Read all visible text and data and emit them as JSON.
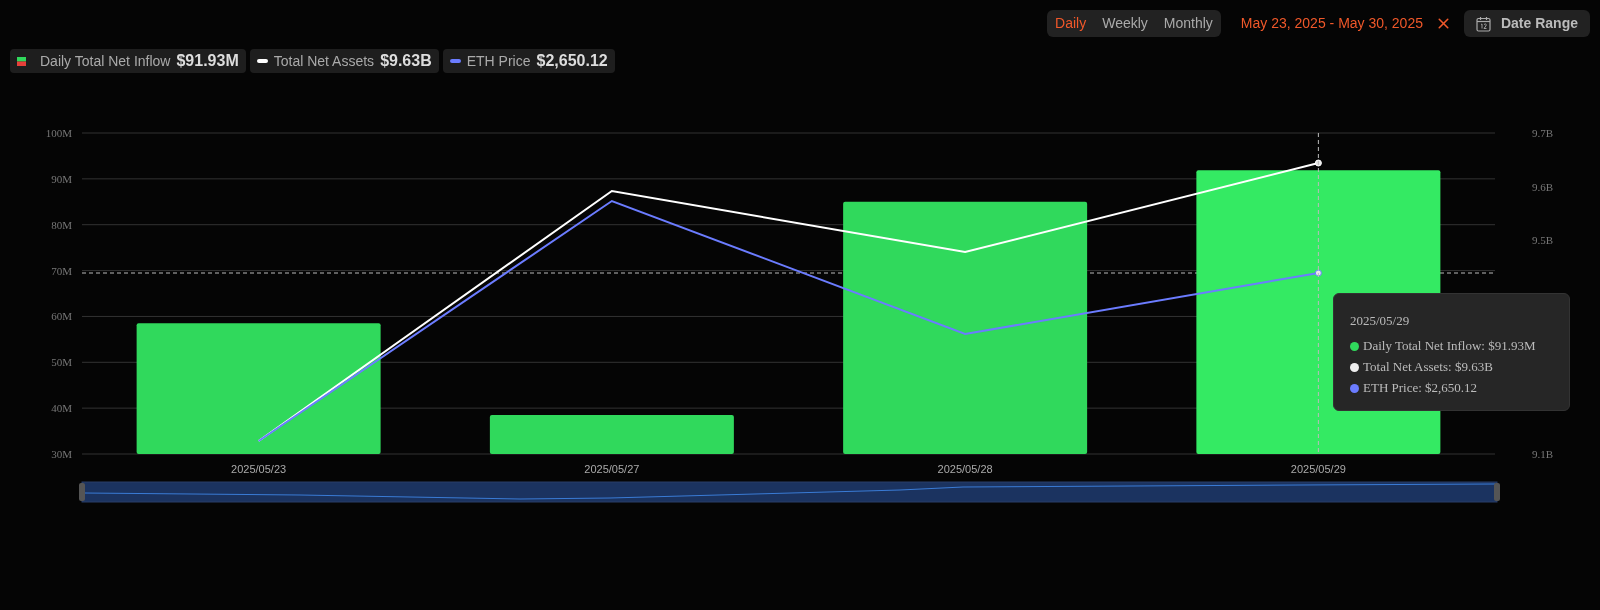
{
  "controls": {
    "periods": [
      {
        "label": "Daily",
        "selected": true
      },
      {
        "label": "Weekly",
        "selected": false
      },
      {
        "label": "Monthly",
        "selected": false
      }
    ],
    "date_range": "May 23, 2025 - May 30, 2025",
    "date_range_button": "Date Range"
  },
  "legend": [
    {
      "value": "$91.93M",
      "kind": "bar"
    },
    {
      "label": "Total Net Assets",
      "value": "$9.63B",
      "kind": "line",
      "color": "#ffffff"
    },
    {
      "label": "ETH Price",
      "value": "$2,650.12",
      "kind": "line",
      "color": "#6b7cff"
    }
  ],
  "chart_data": {
    "type": "bar",
    "grid": true,
    "categories": [
      "2025/05/23",
      "2025/05/27",
      "2025/05/28",
      "2025/05/29"
    ],
    "series": [
      {
        "name": "Daily Total Net Inflow",
        "color": "#30d95c",
        "values": [
          58.5,
          38.5,
          85,
          91.9
        ]
      }
    ],
    "ylim": [
      30,
      100
    ],
    "yticks": [
      {
        "value": 30,
        "label": "30M"
      },
      {
        "value": 40,
        "label": "40M"
      },
      {
        "value": 50,
        "label": "50M"
      },
      {
        "value": 60,
        "label": "60M"
      },
      {
        "value": 70,
        "label": "70M"
      },
      {
        "value": 80,
        "label": "80M"
      },
      {
        "value": 90,
        "label": "90M"
      },
      {
        "value": 100,
        "label": "100M"
      }
    ]
  },
  "right_axis_labels": [
    "9.7B",
    "9.6B",
    "9.5B",
    "9.1B"
  ],
  "tooltip": {
    "title": "2025/05/29",
    "rows": [
      {
        "label": "Daily Total Net Inflow: $91.93M",
        "color": "#30d95c"
      },
      {
        "label": "Total Net Assets: $9.63B",
        "color": "#eeeeee"
      },
      {
        "label": "ETH Price: $2,650.12",
        "color": "#6b7cff"
      }
    ]
  }
}
